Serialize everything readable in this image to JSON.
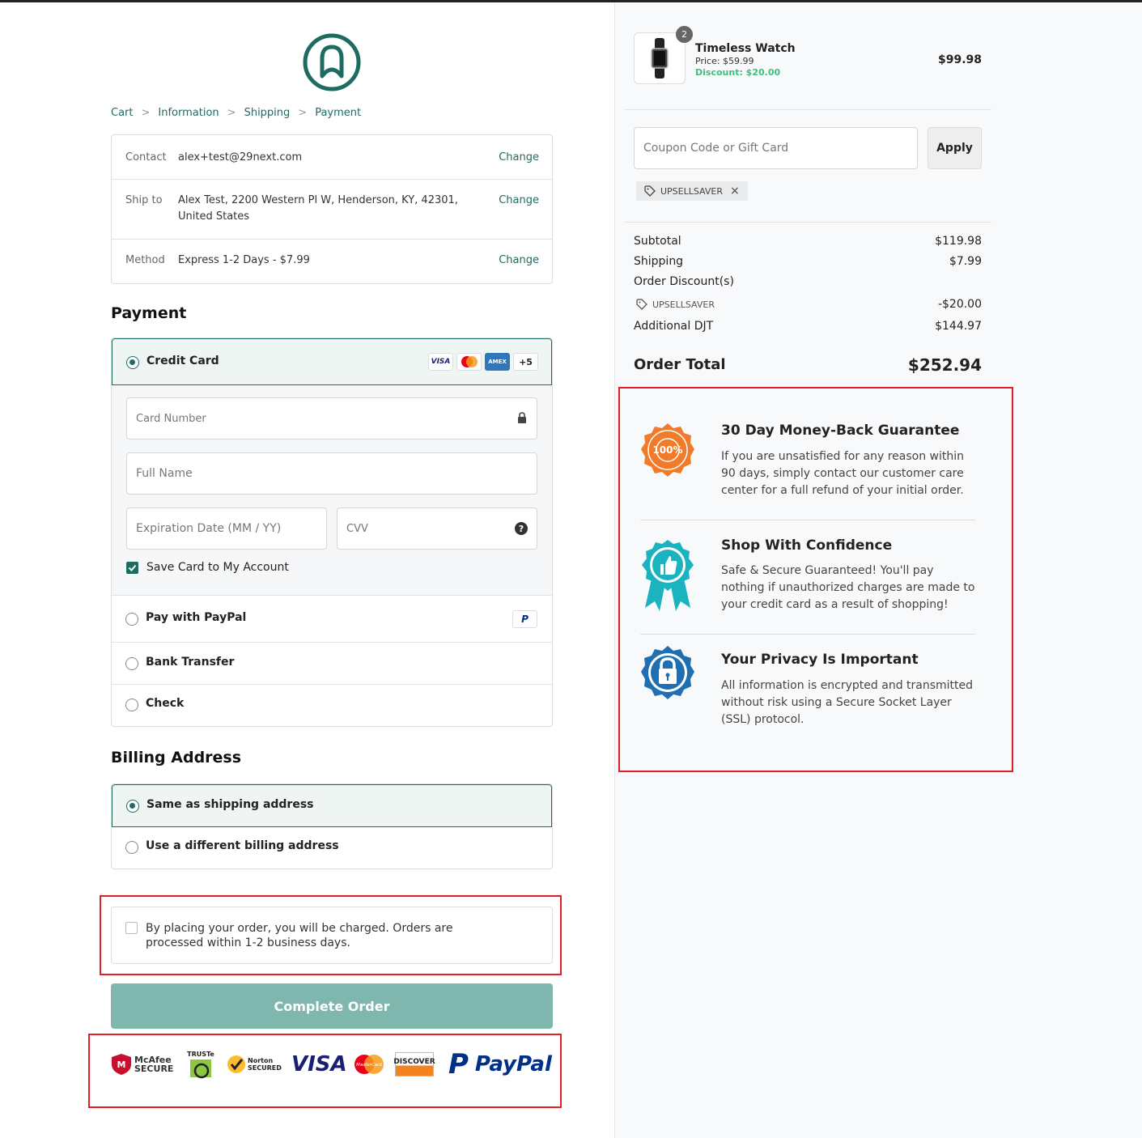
{
  "breadcrumb": {
    "items": [
      "Cart",
      "Information",
      "Shipping",
      "Payment"
    ],
    "separator": ">"
  },
  "summary": {
    "contact": {
      "label": "Contact",
      "value": "alex+test@29next.com",
      "change": "Change"
    },
    "ship_to": {
      "label": "Ship to",
      "value": "Alex Test, 2200 Western Pl W, Henderson, KY, 42301, United States",
      "change": "Change"
    },
    "method": {
      "label": "Method",
      "value": "Express 1-2 Days - $7.99",
      "change": "Change"
    }
  },
  "payment": {
    "heading": "Payment",
    "credit_card": {
      "label": "Credit Card",
      "cards": [
        "VISA",
        "MC",
        "AMEX",
        "+5"
      ],
      "selected": true
    },
    "card_number_placeholder": "Card Number",
    "full_name_placeholder": "Full Name",
    "expiry_placeholder": "Expiration Date (MM / YY)",
    "cvv_placeholder": "CVV",
    "save_card_label": "Save Card to My Account",
    "save_card_checked": true,
    "paypal_label": "Pay with PayPal",
    "bank_label": "Bank Transfer",
    "check_label": "Check"
  },
  "billing": {
    "heading": "Billing Address",
    "same_label": "Same as shipping address",
    "different_label": "Use a different billing address"
  },
  "terms": {
    "text": "By placing your order, you will be charged. Orders are processed within 1-2 business days."
  },
  "complete_order_label": "Complete Order",
  "trust_badges": [
    "McAfee SECURE",
    "TRUSTe",
    "Norton SECURED",
    "VISA",
    "MasterCard",
    "DISCOVER",
    "PayPal"
  ],
  "product": {
    "name": "Timeless Watch",
    "price": "Price: $59.99",
    "discount": "Discount: $20.00",
    "qty": "2",
    "total": "$99.98"
  },
  "coupon": {
    "placeholder": "Coupon Code or Gift Card",
    "apply": "Apply",
    "applied_code": "UPSELLSAVER"
  },
  "totals": {
    "subtotal_label": "Subtotal",
    "subtotal": "$119.98",
    "shipping_label": "Shipping",
    "shipping": "$7.99",
    "discounts_label": "Order Discount(s)",
    "discount_code": "UPSELLSAVER",
    "discount_amount": "-$20.00",
    "additional_label": "Additional DJT",
    "additional": "$144.97",
    "order_total_label": "Order Total",
    "order_total": "$252.94"
  },
  "guarantees": [
    {
      "title": "30 Day Money-Back Guarantee",
      "body": "If you are unsatisfied for any reason within 90 days, simply contact our customer care center for a full refund of your initial order.",
      "badge_text": "100%"
    },
    {
      "title": "Shop With Confidence",
      "body": "Safe & Secure Guaranteed! You'll pay nothing if unauthorized charges are made to your credit card as a result of shopping!"
    },
    {
      "title": "Your Privacy Is Important",
      "body": "All information is encrypted and transmitted without risk using a Secure Socket Layer (SSL) protocol."
    }
  ],
  "colors": {
    "brand": "#1e6b62",
    "button": "#7fb6ae",
    "highlight": "#e41e26",
    "discount": "#3fbf7f"
  }
}
